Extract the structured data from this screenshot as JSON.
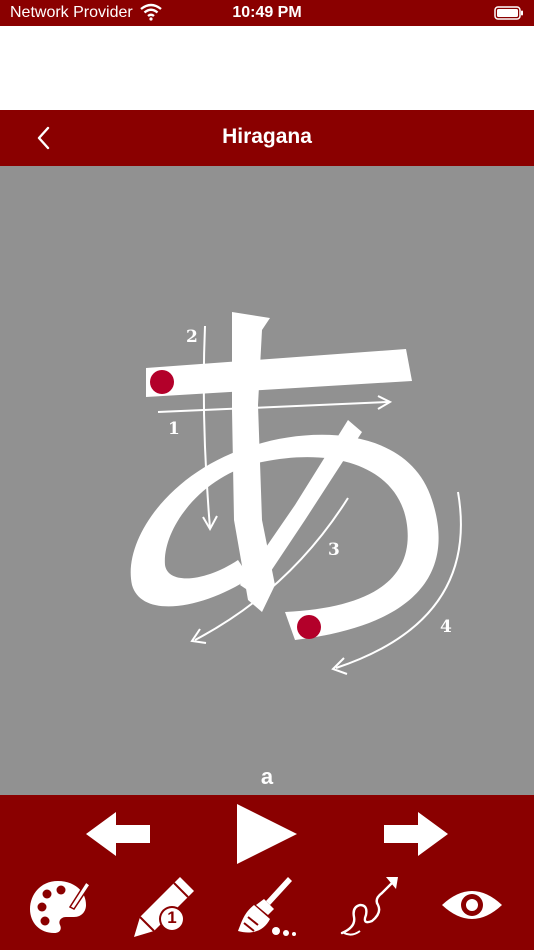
{
  "status_bar": {
    "carrier": "Network Provider",
    "time": "10:49 PM",
    "wifi_icon": "wifi-icon",
    "battery_icon": "battery-icon"
  },
  "nav": {
    "title": "Hiragana",
    "back_icon": "chevron-left-icon"
  },
  "character": {
    "romaji": "a",
    "stroke_numbers": [
      "1",
      "2",
      "3",
      "4"
    ]
  },
  "toolbar": {
    "row1": [
      "arrow-left-icon",
      "play-icon",
      "arrow-right-icon"
    ],
    "row2": [
      "palette-icon",
      "pencil-icon",
      "broom-icon",
      "stroke-path-icon",
      "eye-icon"
    ],
    "pencil_badge": "1"
  },
  "colors": {
    "brand": "#8a0000",
    "canvas": "#919191",
    "start_dot": "#b3002a",
    "ink": "#ffffff"
  }
}
